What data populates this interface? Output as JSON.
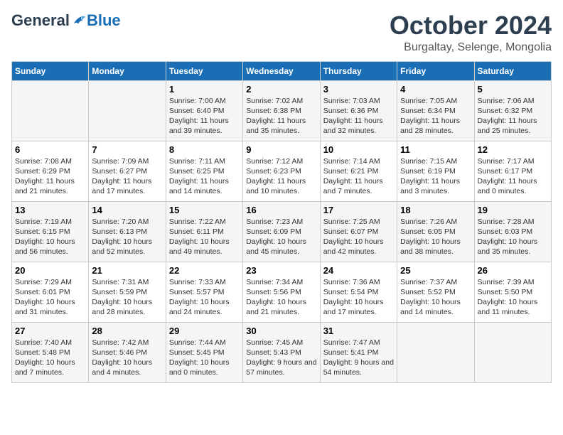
{
  "logo": {
    "general": "General",
    "blue": "Blue"
  },
  "title": "October 2024",
  "location": "Burgaltay, Selenge, Mongolia",
  "days_of_week": [
    "Sunday",
    "Monday",
    "Tuesday",
    "Wednesday",
    "Thursday",
    "Friday",
    "Saturday"
  ],
  "weeks": [
    [
      {
        "day": "",
        "info": ""
      },
      {
        "day": "",
        "info": ""
      },
      {
        "day": "1",
        "info": "Sunrise: 7:00 AM\nSunset: 6:40 PM\nDaylight: 11 hours and 39 minutes."
      },
      {
        "day": "2",
        "info": "Sunrise: 7:02 AM\nSunset: 6:38 PM\nDaylight: 11 hours and 35 minutes."
      },
      {
        "day": "3",
        "info": "Sunrise: 7:03 AM\nSunset: 6:36 PM\nDaylight: 11 hours and 32 minutes."
      },
      {
        "day": "4",
        "info": "Sunrise: 7:05 AM\nSunset: 6:34 PM\nDaylight: 11 hours and 28 minutes."
      },
      {
        "day": "5",
        "info": "Sunrise: 7:06 AM\nSunset: 6:32 PM\nDaylight: 11 hours and 25 minutes."
      }
    ],
    [
      {
        "day": "6",
        "info": "Sunrise: 7:08 AM\nSunset: 6:29 PM\nDaylight: 11 hours and 21 minutes."
      },
      {
        "day": "7",
        "info": "Sunrise: 7:09 AM\nSunset: 6:27 PM\nDaylight: 11 hours and 17 minutes."
      },
      {
        "day": "8",
        "info": "Sunrise: 7:11 AM\nSunset: 6:25 PM\nDaylight: 11 hours and 14 minutes."
      },
      {
        "day": "9",
        "info": "Sunrise: 7:12 AM\nSunset: 6:23 PM\nDaylight: 11 hours and 10 minutes."
      },
      {
        "day": "10",
        "info": "Sunrise: 7:14 AM\nSunset: 6:21 PM\nDaylight: 11 hours and 7 minutes."
      },
      {
        "day": "11",
        "info": "Sunrise: 7:15 AM\nSunset: 6:19 PM\nDaylight: 11 hours and 3 minutes."
      },
      {
        "day": "12",
        "info": "Sunrise: 7:17 AM\nSunset: 6:17 PM\nDaylight: 11 hours and 0 minutes."
      }
    ],
    [
      {
        "day": "13",
        "info": "Sunrise: 7:19 AM\nSunset: 6:15 PM\nDaylight: 10 hours and 56 minutes."
      },
      {
        "day": "14",
        "info": "Sunrise: 7:20 AM\nSunset: 6:13 PM\nDaylight: 10 hours and 52 minutes."
      },
      {
        "day": "15",
        "info": "Sunrise: 7:22 AM\nSunset: 6:11 PM\nDaylight: 10 hours and 49 minutes."
      },
      {
        "day": "16",
        "info": "Sunrise: 7:23 AM\nSunset: 6:09 PM\nDaylight: 10 hours and 45 minutes."
      },
      {
        "day": "17",
        "info": "Sunrise: 7:25 AM\nSunset: 6:07 PM\nDaylight: 10 hours and 42 minutes."
      },
      {
        "day": "18",
        "info": "Sunrise: 7:26 AM\nSunset: 6:05 PM\nDaylight: 10 hours and 38 minutes."
      },
      {
        "day": "19",
        "info": "Sunrise: 7:28 AM\nSunset: 6:03 PM\nDaylight: 10 hours and 35 minutes."
      }
    ],
    [
      {
        "day": "20",
        "info": "Sunrise: 7:29 AM\nSunset: 6:01 PM\nDaylight: 10 hours and 31 minutes."
      },
      {
        "day": "21",
        "info": "Sunrise: 7:31 AM\nSunset: 5:59 PM\nDaylight: 10 hours and 28 minutes."
      },
      {
        "day": "22",
        "info": "Sunrise: 7:33 AM\nSunset: 5:57 PM\nDaylight: 10 hours and 24 minutes."
      },
      {
        "day": "23",
        "info": "Sunrise: 7:34 AM\nSunset: 5:56 PM\nDaylight: 10 hours and 21 minutes."
      },
      {
        "day": "24",
        "info": "Sunrise: 7:36 AM\nSunset: 5:54 PM\nDaylight: 10 hours and 17 minutes."
      },
      {
        "day": "25",
        "info": "Sunrise: 7:37 AM\nSunset: 5:52 PM\nDaylight: 10 hours and 14 minutes."
      },
      {
        "day": "26",
        "info": "Sunrise: 7:39 AM\nSunset: 5:50 PM\nDaylight: 10 hours and 11 minutes."
      }
    ],
    [
      {
        "day": "27",
        "info": "Sunrise: 7:40 AM\nSunset: 5:48 PM\nDaylight: 10 hours and 7 minutes."
      },
      {
        "day": "28",
        "info": "Sunrise: 7:42 AM\nSunset: 5:46 PM\nDaylight: 10 hours and 4 minutes."
      },
      {
        "day": "29",
        "info": "Sunrise: 7:44 AM\nSunset: 5:45 PM\nDaylight: 10 hours and 0 minutes."
      },
      {
        "day": "30",
        "info": "Sunrise: 7:45 AM\nSunset: 5:43 PM\nDaylight: 9 hours and 57 minutes."
      },
      {
        "day": "31",
        "info": "Sunrise: 7:47 AM\nSunset: 5:41 PM\nDaylight: 9 hours and 54 minutes."
      },
      {
        "day": "",
        "info": ""
      },
      {
        "day": "",
        "info": ""
      }
    ]
  ]
}
